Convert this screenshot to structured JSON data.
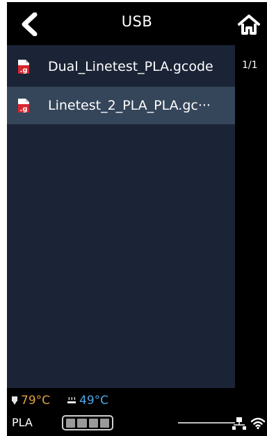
{
  "header": {
    "title": "USB"
  },
  "files": [
    {
      "name": "Dual_Linetest_PLA.gcode",
      "selected": false
    },
    {
      "name": "Linetest_2_PLA_PLA.gc···",
      "selected": true
    }
  ],
  "pagination": {
    "label": "1/1"
  },
  "status": {
    "nozzle_temp": "79°C",
    "bed_temp": "49°C",
    "material": "PLA",
    "spool_level_segments": 4
  },
  "icons": {
    "back": "chevron-left-icon",
    "home": "home-icon",
    "file": "gcode-file-icon",
    "nozzle": "nozzle-icon",
    "bed": "heated-bed-icon",
    "network": "ethernet-icon",
    "wifi": "wifi-icon"
  },
  "colors": {
    "list_background": "#1b2436",
    "selected_row": "#35455a",
    "nozzle_temp": "#e0a040",
    "bed_temp": "#4ba6e8",
    "file_icon_red": "#d8262f"
  }
}
